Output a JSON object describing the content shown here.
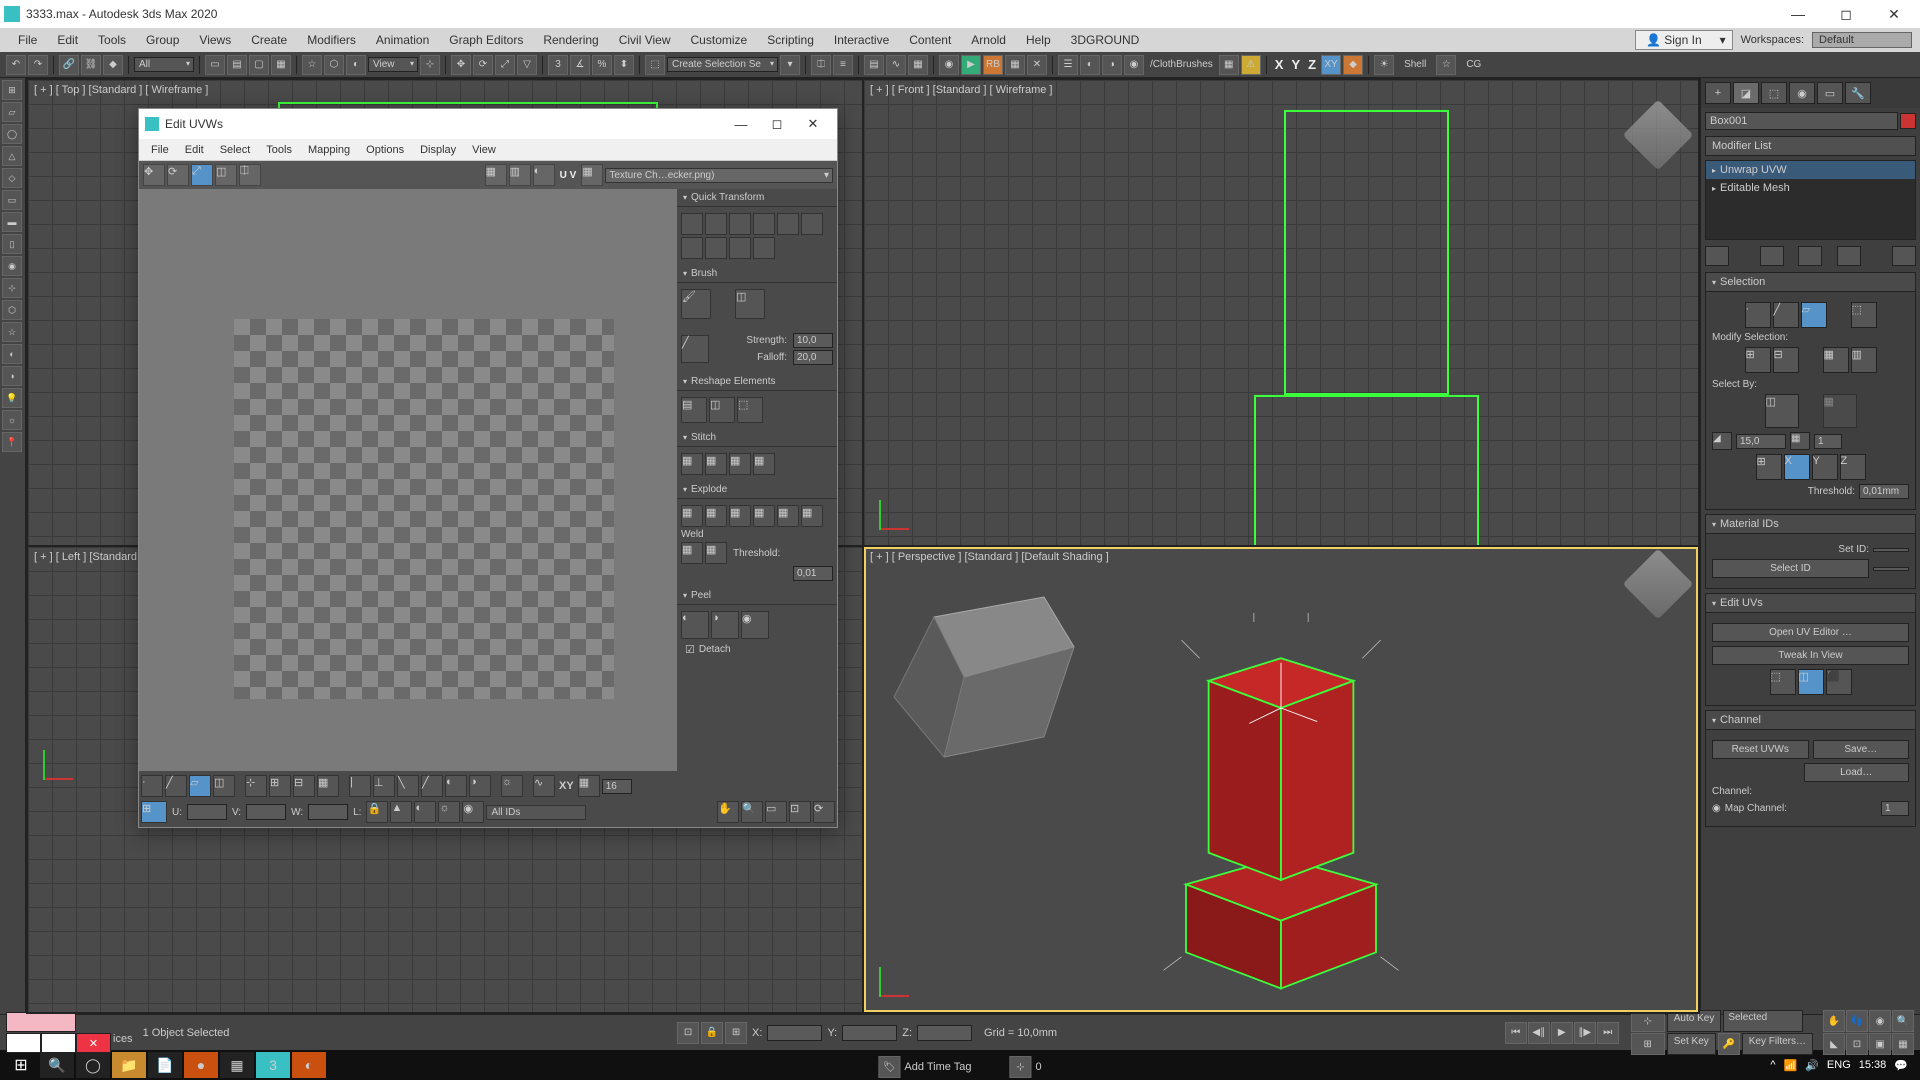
{
  "titlebar": {
    "title": "3333.max - Autodesk 3ds Max 2020"
  },
  "menubar": {
    "items": [
      "File",
      "Edit",
      "Tools",
      "Group",
      "Views",
      "Create",
      "Modifiers",
      "Animation",
      "Graph Editors",
      "Rendering",
      "Civil View",
      "Customize",
      "Scripting",
      "Interactive",
      "Content",
      "Arnold",
      "Help",
      "3DGROUND"
    ],
    "signin": "Sign In",
    "workspaces_label": "Workspaces:",
    "workspaces_value": "Default"
  },
  "toolbar": {
    "all": "All",
    "view": "View",
    "create_sel": "Create Selection Se",
    "cloth": "/ClothBrushes",
    "x": "X",
    "y": "Y",
    "z": "Z",
    "shell": "Shell",
    "cg": "CG"
  },
  "viewports": {
    "top": "[ + ] [ Top ] [Standard ] [ Wireframe ]",
    "front": "[ + ] [ Front ] [Standard ] [ Wireframe ]",
    "left": "[ + ] [ Left ] [Standard",
    "persp": "[ + ] [ Perspective ] [Standard ] [Default Shading ]"
  },
  "uvw": {
    "title": "Edit UVWs",
    "menu": [
      "File",
      "Edit",
      "Select",
      "Tools",
      "Mapping",
      "Options",
      "Display",
      "View"
    ],
    "texture": "Texture Ch…ecker.png)",
    "uv_label": "U V",
    "rollups": {
      "qtrans": "Quick Transform",
      "brush": "Brush",
      "strength_lbl": "Strength:",
      "strength_val": "10,0",
      "falloff_lbl": "Falloff:",
      "falloff_val": "20,0",
      "reshape": "Reshape Elements",
      "stitch": "Stitch",
      "explode": "Explode",
      "weld_lbl": "Weld",
      "threshold_lbl": "Threshold:",
      "threshold_val": "0,01",
      "peel": "Peel",
      "detach": "Detach"
    },
    "bottom": {
      "xy": "XY",
      "grid_val": "16",
      "u": "U:",
      "v": "V:",
      "w": "W:",
      "l": "L:",
      "all_ids": "All IDs"
    }
  },
  "cmdpanel": {
    "obj_name": "Box001",
    "mod_list": "Modifier List",
    "stack": [
      "Unwrap UVW",
      "Editable Mesh"
    ],
    "selection": {
      "hdr": "Selection",
      "modify_sel": "Modify Selection:",
      "select_by": "Select By:",
      "angle": "15,0",
      "count": "1",
      "threshold_lbl": "Threshold:",
      "threshold_val": "0,01mm"
    },
    "matids": {
      "hdr": "Material IDs",
      "set_id": "Set ID:",
      "select_id": "Select ID"
    },
    "edituvs": {
      "hdr": "Edit UVs",
      "open": "Open UV Editor …",
      "tweak": "Tweak In View"
    },
    "channel": {
      "hdr": "Channel",
      "reset": "Reset UVWs",
      "save": "Save…",
      "load": "Load…",
      "channel_lbl": "Channel:",
      "map_channel": "Map Channel:",
      "map_val": "1"
    }
  },
  "status": {
    "text_area": "ices",
    "selected": "1 Object Selected",
    "x": "X:",
    "y": "Y:",
    "z": "Z:",
    "grid": "Grid = 10,0mm",
    "add_time": "Add Time Tag",
    "auto_key": "Auto Key",
    "set_key": "Set Key",
    "selected_drop": "Selected",
    "key_filters": "Key Filters…",
    "zero": "0"
  },
  "taskbar": {
    "lang": "ENG",
    "time": "15:38",
    "date": ""
  }
}
